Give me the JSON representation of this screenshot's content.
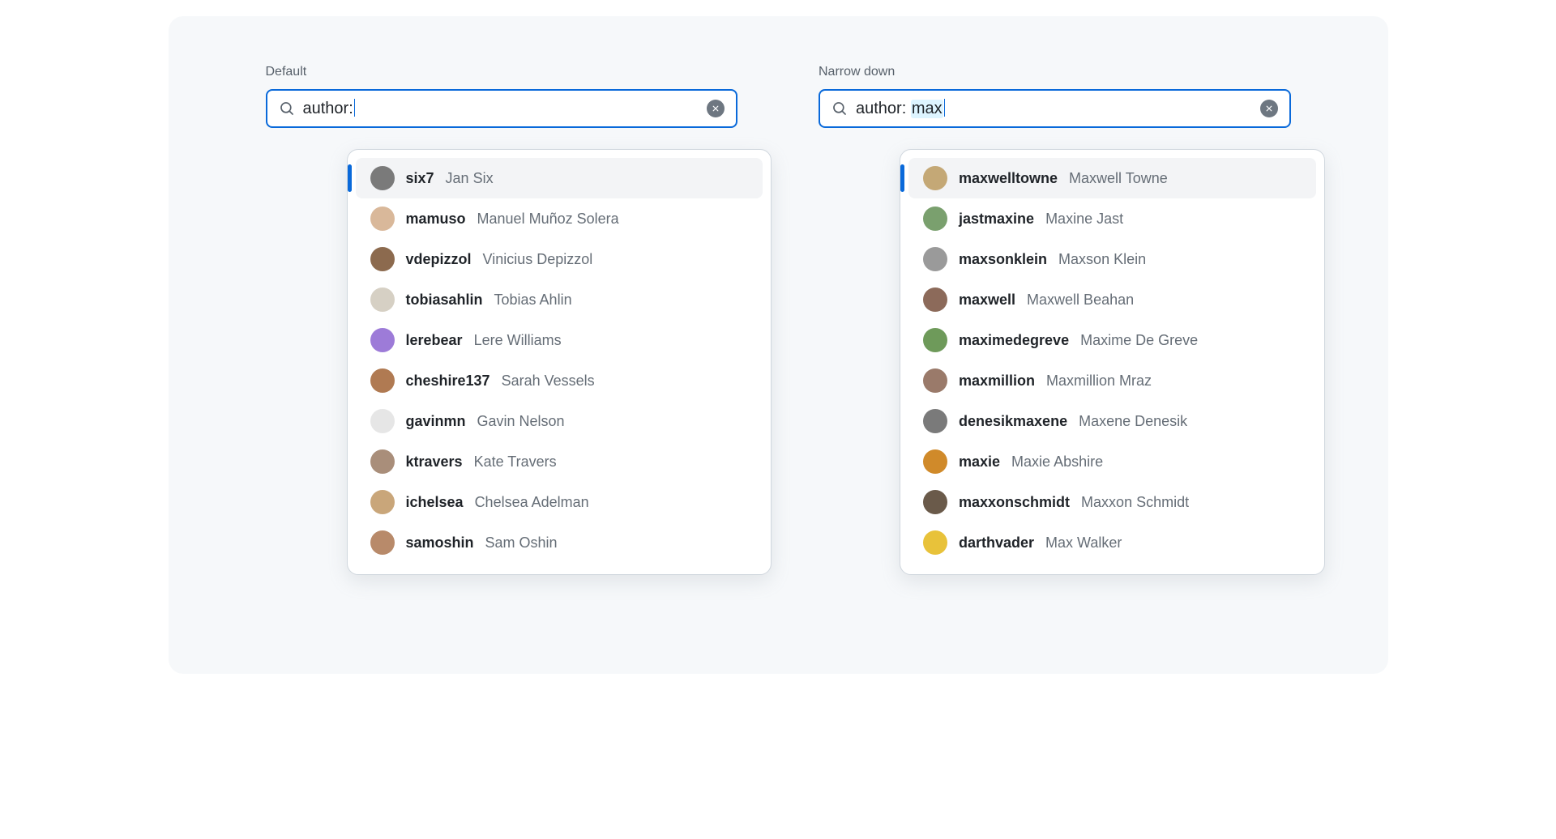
{
  "panels": [
    {
      "label": "Default",
      "query_prefix": "author:",
      "query_highlight": "",
      "options": [
        {
          "handle": "six7",
          "name": "Jan Six",
          "avatar_color": "#7a7a7a"
        },
        {
          "handle": "mamuso",
          "name": "Manuel Muñoz Solera",
          "avatar_color": "#d9b89a"
        },
        {
          "handle": "vdepizzol",
          "name": "Vinicius Depizzol",
          "avatar_color": "#8c6a4e"
        },
        {
          "handle": "tobiasahlin",
          "name": "Tobias Ahlin",
          "avatar_color": "#d6d0c4"
        },
        {
          "handle": "lerebear",
          "name": "Lere Williams",
          "avatar_color": "#9d7bd8"
        },
        {
          "handle": "cheshire137",
          "name": "Sarah Vessels",
          "avatar_color": "#b07a52"
        },
        {
          "handle": "gavinmn",
          "name": "Gavin Nelson",
          "avatar_color": "#e6e6e6"
        },
        {
          "handle": "ktravers",
          "name": "Kate Travers",
          "avatar_color": "#a98e7a"
        },
        {
          "handle": "ichelsea",
          "name": "Chelsea Adelman",
          "avatar_color": "#c9a67a"
        },
        {
          "handle": "samoshin",
          "name": "Sam Oshin",
          "avatar_color": "#b88a6a"
        }
      ]
    },
    {
      "label": "Narrow down",
      "query_prefix": "author: ",
      "query_highlight": "max",
      "options": [
        {
          "handle": "maxwelltowne",
          "name": "Maxwell Towne",
          "avatar_color": "#c4a876"
        },
        {
          "handle": "jastmaxine",
          "name": "Maxine Jast",
          "avatar_color": "#7aa06e"
        },
        {
          "handle": "maxsonklein",
          "name": "Maxson Klein",
          "avatar_color": "#9a9a9a"
        },
        {
          "handle": "maxwell",
          "name": "Maxwell Beahan",
          "avatar_color": "#8c6a5a"
        },
        {
          "handle": "maximedegreve",
          "name": "Maxime De Greve",
          "avatar_color": "#6e9a5a"
        },
        {
          "handle": "maxmillion",
          "name": "Maxmillion Mraz",
          "avatar_color": "#9a7a6a"
        },
        {
          "handle": "denesikmaxene",
          "name": "Maxene Denesik",
          "avatar_color": "#7a7a7a"
        },
        {
          "handle": "maxie",
          "name": "Maxie Abshire",
          "avatar_color": "#d08a2a"
        },
        {
          "handle": "maxxonschmidt",
          "name": "Maxxon Schmidt",
          "avatar_color": "#6a5a4a"
        },
        {
          "handle": "darthvader",
          "name": "Max Walker",
          "avatar_color": "#e8c23a"
        }
      ]
    }
  ]
}
